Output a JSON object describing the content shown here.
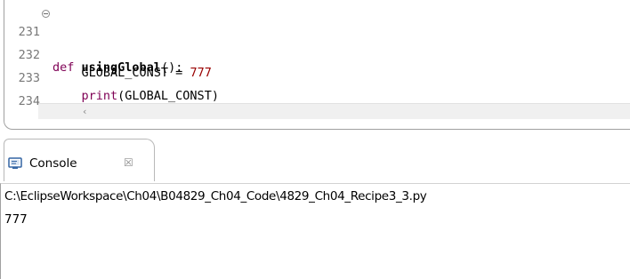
{
  "editor": {
    "lines": [
      {
        "number": "231",
        "parts": {
          "kw": "def",
          "space": " ",
          "name": "usingGlobal",
          "rest": "():"
        }
      },
      {
        "number": "232",
        "parts": {
          "indent": "    ",
          "text": "GLOBAL_CONST = ",
          "num": "777"
        }
      },
      {
        "number": "233",
        "parts": {
          "indent": "    ",
          "builtin": "print",
          "rest": "(GLOBAL_CONST)"
        }
      },
      {
        "number": "234",
        "parts": {}
      }
    ],
    "scroll_left_glyph": "‹"
  },
  "console": {
    "tab_label": "Console",
    "close_glyph": "☒",
    "icon": "console-icon",
    "path": "C:\\EclipseWorkspace\\Ch04\\B04829_Ch04_Code\\4829_Ch04_Recipe3_3.py",
    "output": "777"
  },
  "colors": {
    "keyword": "#7f0055",
    "number": "#990000",
    "line_number": "#787878",
    "border": "#a0a0a0"
  }
}
